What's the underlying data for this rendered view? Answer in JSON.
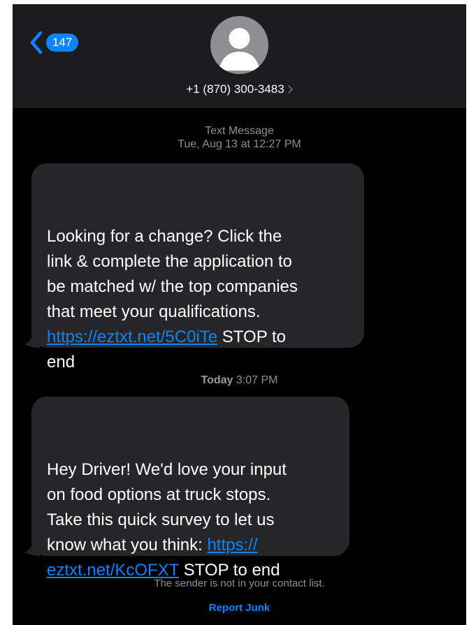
{
  "header": {
    "back_badge": "147",
    "contact_number": "+1 (870) 300-3483"
  },
  "messages": [
    {
      "stamp_label": "Text Message",
      "stamp_date": "Tue, Aug 13",
      "stamp_time": "at 12:27 PM",
      "text_before": "Looking for a change? Click the\nlink & complete the application to\nbe matched w/ the top companies\nthat meet your qualifications.\n",
      "link": "https://eztxt.net/5C0iTe",
      "text_after": " STOP to\nend"
    },
    {
      "stamp_day": "Today",
      "stamp_time": "3:07 PM",
      "text_before": "Hey Driver! We'd love your input\non food options at truck stops.\nTake this quick survey to let us\nknow what you think: ",
      "link_line1": "https://",
      "link_line2": "eztxt.net/KcOFXT",
      "text_after": " STOP to end"
    }
  ],
  "footer": {
    "note": "The sender is not in your contact list.",
    "report_junk": "Report Junk"
  },
  "colors": {
    "background": "#000000",
    "header": "#1c1c1e",
    "bubble": "#262628",
    "accent": "#0a84ff",
    "muted": "#8e8e93"
  }
}
